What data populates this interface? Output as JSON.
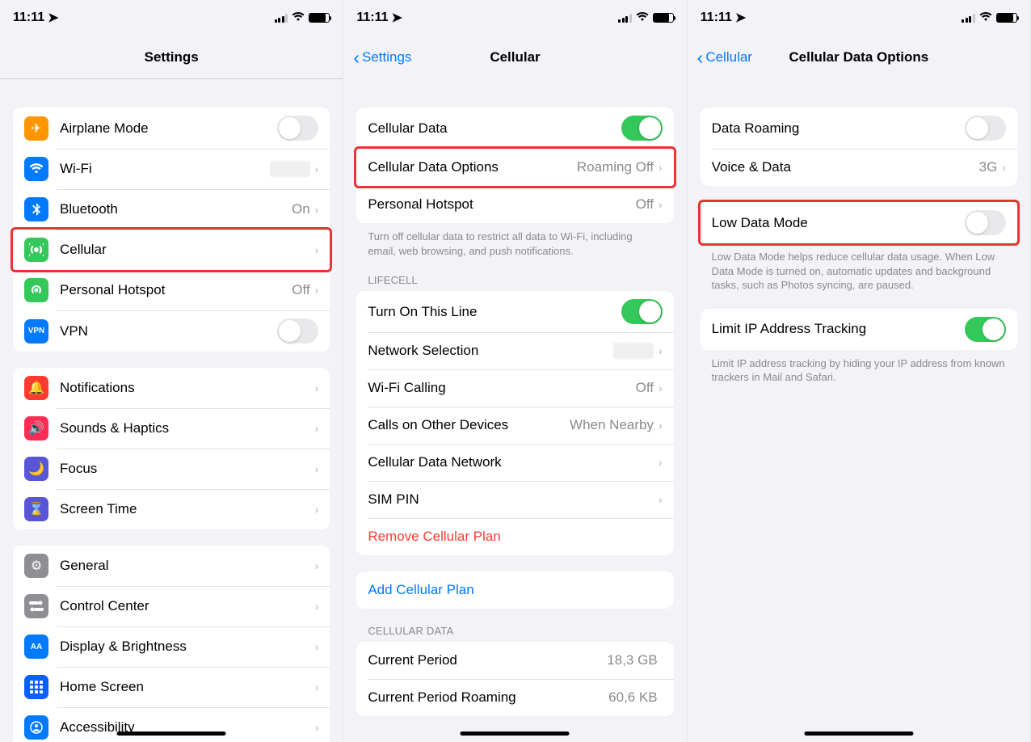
{
  "status": {
    "time": "11:11"
  },
  "screen1": {
    "title": "Settings",
    "group1": [
      {
        "label": "Airplane Mode",
        "type": "toggle",
        "on": false,
        "icon": "airplane",
        "color": "ic-orange"
      },
      {
        "label": "Wi-Fi",
        "type": "nav",
        "value": "",
        "blurred": true,
        "icon": "wifi",
        "color": "ic-blue"
      },
      {
        "label": "Bluetooth",
        "type": "nav",
        "value": "On",
        "icon": "bluetooth",
        "color": "ic-blue"
      },
      {
        "label": "Cellular",
        "type": "nav",
        "icon": "antenna",
        "color": "ic-green",
        "highlighted": true
      },
      {
        "label": "Personal Hotspot",
        "type": "nav",
        "value": "Off",
        "icon": "hotspot",
        "color": "ic-green"
      },
      {
        "label": "VPN",
        "type": "toggle",
        "on": false,
        "icon": "vpn",
        "color": "ic-blue",
        "iconText": "VPN"
      }
    ],
    "group2": [
      {
        "label": "Notifications",
        "icon": "bell",
        "color": "ic-red"
      },
      {
        "label": "Sounds & Haptics",
        "icon": "speaker",
        "color": "ic-pink"
      },
      {
        "label": "Focus",
        "icon": "moon",
        "color": "ic-indigo"
      },
      {
        "label": "Screen Time",
        "icon": "hourglass",
        "color": "ic-indigo"
      }
    ],
    "group3": [
      {
        "label": "General",
        "icon": "gear",
        "color": "ic-gray"
      },
      {
        "label": "Control Center",
        "icon": "switches",
        "color": "ic-gray"
      },
      {
        "label": "Display & Brightness",
        "icon": "aa",
        "color": "ic-blue",
        "iconText": "AA"
      },
      {
        "label": "Home Screen",
        "icon": "grid",
        "color": "ic-darkblue"
      },
      {
        "label": "Accessibility",
        "icon": "person",
        "color": "ic-blue"
      }
    ]
  },
  "screen2": {
    "back": "Settings",
    "title": "Cellular",
    "group1": [
      {
        "label": "Cellular Data",
        "type": "toggle",
        "on": true
      },
      {
        "label": "Cellular Data Options",
        "type": "nav",
        "value": "Roaming Off",
        "highlighted": true
      },
      {
        "label": "Personal Hotspot",
        "type": "nav",
        "value": "Off"
      }
    ],
    "footer1": "Turn off cellular data to restrict all data to Wi-Fi, including email, web browsing, and push notifications.",
    "header2": "LIFECELL",
    "group2": [
      {
        "label": "Turn On This Line",
        "type": "toggle",
        "on": true
      },
      {
        "label": "Network Selection",
        "type": "nav",
        "blurred": true
      },
      {
        "label": "Wi-Fi Calling",
        "type": "nav",
        "value": "Off"
      },
      {
        "label": "Calls on Other Devices",
        "type": "nav",
        "value": "When Nearby"
      },
      {
        "label": "Cellular Data Network",
        "type": "nav"
      },
      {
        "label": "SIM PIN",
        "type": "nav"
      },
      {
        "label": "Remove Cellular Plan",
        "type": "nav",
        "destructive": true
      }
    ],
    "group3": [
      {
        "label": "Add Cellular Plan",
        "type": "nav",
        "link": true
      }
    ],
    "header4": "CELLULAR DATA",
    "group4": [
      {
        "label": "Current Period",
        "type": "value",
        "value": "18,3 GB"
      },
      {
        "label": "Current Period Roaming",
        "type": "value",
        "value": "60,6 KB"
      }
    ]
  },
  "screen3": {
    "back": "Cellular",
    "title": "Cellular Data Options",
    "group1": [
      {
        "label": "Data Roaming",
        "type": "toggle",
        "on": false
      },
      {
        "label": "Voice & Data",
        "type": "nav",
        "value": "3G"
      }
    ],
    "group2": [
      {
        "label": "Low Data Mode",
        "type": "toggle",
        "on": false,
        "highlighted": true
      }
    ],
    "footer2": "Low Data Mode helps reduce cellular data usage. When Low Data Mode is turned on, automatic updates and background tasks, such as Photos syncing, are paused.",
    "group3": [
      {
        "label": "Limit IP Address Tracking",
        "type": "toggle",
        "on": true
      }
    ],
    "footer3": "Limit IP address tracking by hiding your IP address from known trackers in Mail and Safari."
  }
}
